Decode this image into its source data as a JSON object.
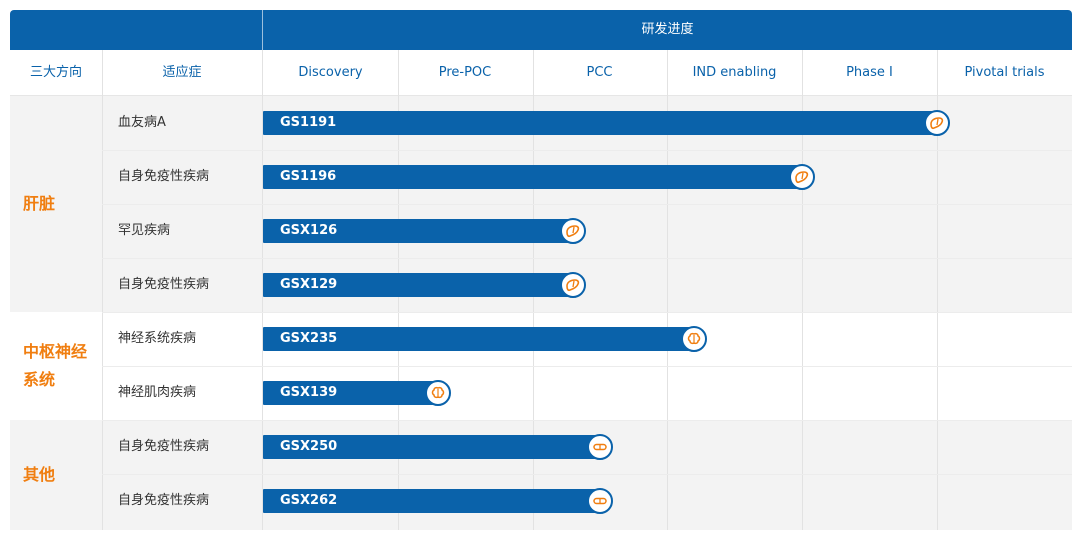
{
  "header": {
    "title": "研发进度",
    "col_category": "三大方向",
    "col_indication": "适应症",
    "stages": [
      "Discovery",
      "Pre-POC",
      "PCC",
      "IND enabling",
      "Phase I",
      "Pivotal trials"
    ]
  },
  "groups": [
    {
      "category_lines": [
        "肝脏"
      ],
      "rows": [
        {
          "indication": "血友病A",
          "program": "GS1191",
          "icon": "liver-icon"
        },
        {
          "indication": "自身免疫性疾病",
          "program": "GS1196",
          "icon": "liver-icon"
        },
        {
          "indication": "罕见疾病",
          "program": "GSX126",
          "icon": "liver-icon"
        },
        {
          "indication": "自身免疫性疾病",
          "program": "GSX129",
          "icon": "liver-icon"
        }
      ]
    },
    {
      "category_lines": [
        "中枢神经",
        "系统"
      ],
      "rows": [
        {
          "indication": "神经系统疾病",
          "program": "GSX235",
          "icon": "brain-icon"
        },
        {
          "indication": "神经肌肉疾病",
          "program": "GSX139",
          "icon": "brain-icon"
        }
      ]
    },
    {
      "category_lines": [
        "其他"
      ],
      "rows": [
        {
          "indication": "自身免疫性疾病",
          "program": "GSX250",
          "icon": "capsule-icon"
        },
        {
          "indication": "自身免疫性疾病",
          "program": "GSX262",
          "icon": "capsule-icon"
        }
      ]
    }
  ],
  "chart_data": {
    "type": "bar",
    "orientation": "horizontal",
    "title": "研发进度",
    "categories": [
      "Discovery",
      "Pre-POC",
      "PCC",
      "IND enabling",
      "Phase I",
      "Pivotal trials"
    ],
    "programs": [
      "GS1191",
      "GS1196",
      "GSX126",
      "GSX129",
      "GSX235",
      "GSX139",
      "GSX250",
      "GSX262"
    ],
    "progress_stages": [
      5.0,
      4.0,
      2.3,
      2.3,
      3.2,
      1.3,
      2.5,
      2.5
    ],
    "xlim": [
      0,
      6
    ],
    "colors": {
      "bar": "#0a62aa",
      "category_text": "#f07e10",
      "header_bg": "#0a62aa",
      "header_text": "#0a62aa"
    }
  }
}
